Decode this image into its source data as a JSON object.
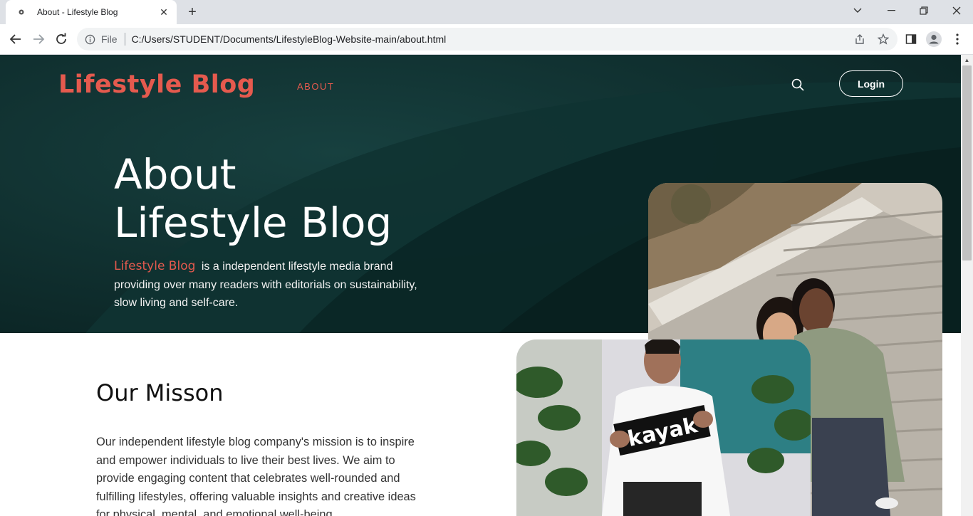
{
  "browser": {
    "tab_title": "About - Lifestyle Blog",
    "scheme_label": "File",
    "url": "C:/Users/STUDENT/Documents/LifestyleBlog-Website-main/about.html"
  },
  "header": {
    "brand": "Lifestyle Blog",
    "nav_about": "ABOUT",
    "login_label": "Login"
  },
  "hero": {
    "title_line1": "About",
    "title_line2": "Lifestyle Blog",
    "desc_highlight": "Lifestyle Blog",
    "desc_rest": "is a independent lifestyle media brand providing over many readers with editorials on sustainability, slow living and self-care."
  },
  "mission": {
    "title": "Our Misson",
    "text": "Our independent lifestyle blog company's mission is to inspire and empower individuals to live their best lives. We aim to provide engaging content that celebrates well-rounded and fulfilling lifestyles, offering valuable insights and creative ideas for physical, mental, and emotional well-being."
  },
  "photo2": {
    "sign_text": "kayak"
  },
  "colors": {
    "accent": "#e55a4e",
    "hero_bg": "#0e2a2a"
  }
}
